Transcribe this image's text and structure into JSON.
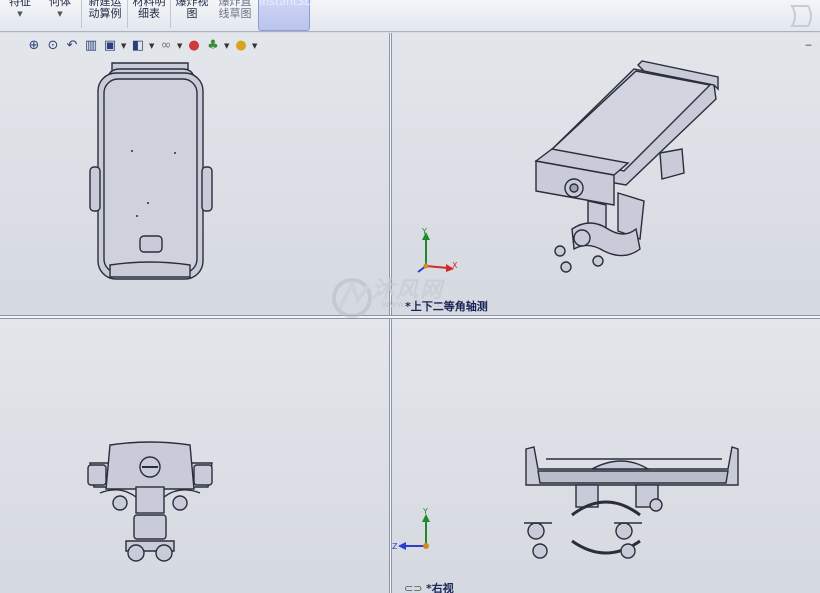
{
  "ribbon": {
    "features": {
      "label": "特征"
    },
    "body": {
      "label": "何体"
    },
    "new_motion": {
      "line1": "新建运",
      "line2": "动算例"
    },
    "bom": {
      "line1": "材料明",
      "line2": "细表"
    },
    "explode_view": {
      "line1": "爆炸视",
      "line2": "图"
    },
    "explode_sketch": {
      "line1": "爆炸直",
      "line2": "线草图"
    },
    "instant3d": {
      "label": "Instant3D"
    }
  },
  "view_toolbar": {
    "icons": [
      "zoom-to-fit-icon",
      "zoom-area-icon",
      "previous-view-icon",
      "section-view-icon",
      "view-orientation-icon",
      "display-style-icon",
      "hide-show-icon",
      "appearance-icon",
      "scene-icon",
      "realview-icon"
    ]
  },
  "views": {
    "top_right_label": "*上下二等角轴测",
    "bottom_right_label": "*右视"
  },
  "triad": {
    "x": "X",
    "y": "Y",
    "z": "Z"
  },
  "watermark": {
    "text": "沐风网",
    "url": "www.mfcad.com"
  },
  "colors": {
    "ribbon_active": "#b9c3ee",
    "axis_x": "#d12a2a",
    "axis_y": "#1f8a2a",
    "axis_z": "#2a3ed1",
    "model_fill": "#c9ccd8",
    "model_line": "#2a2e3a"
  }
}
